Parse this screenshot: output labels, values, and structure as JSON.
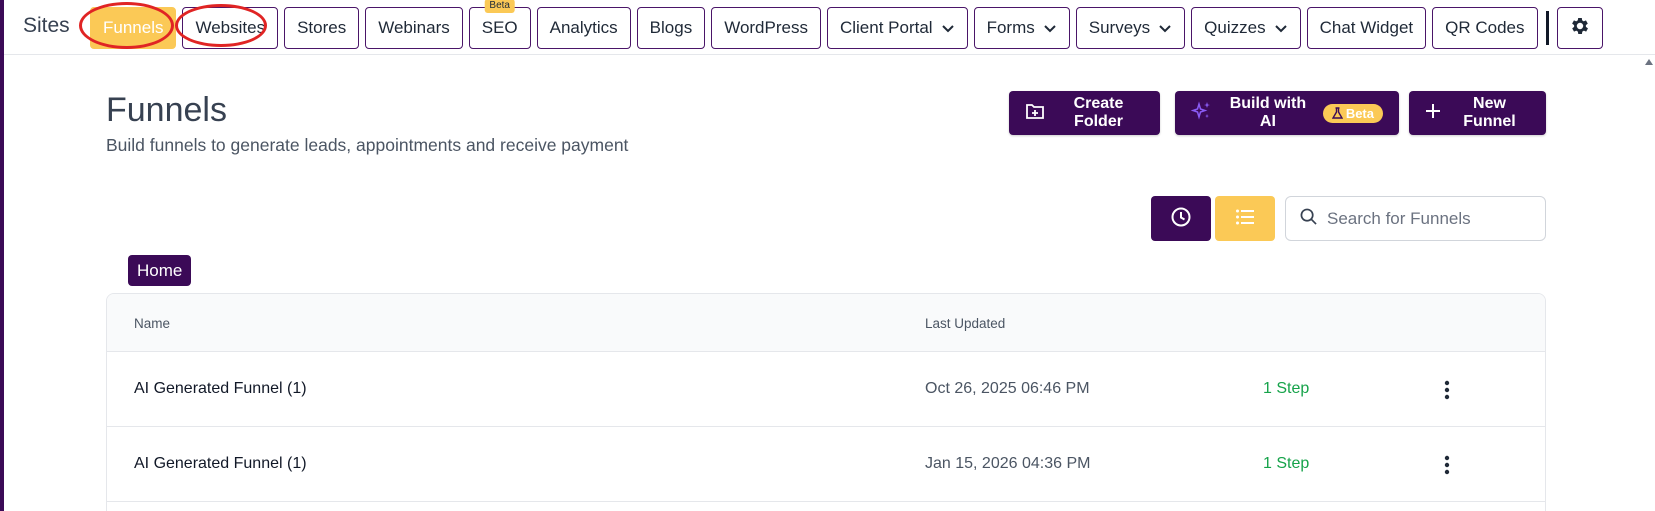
{
  "nav": {
    "brand": "Sites",
    "tabs": [
      {
        "label": "Funnels",
        "active": true
      },
      {
        "label": "Websites"
      },
      {
        "label": "Stores"
      },
      {
        "label": "Webinars"
      },
      {
        "label": "SEO",
        "badge": "Beta"
      },
      {
        "label": "Analytics"
      },
      {
        "label": "Blogs"
      },
      {
        "label": "WordPress"
      },
      {
        "label": "Client Portal",
        "dropdown": true
      },
      {
        "label": "Forms",
        "dropdown": true
      },
      {
        "label": "Surveys",
        "dropdown": true
      },
      {
        "label": "Quizzes",
        "dropdown": true
      },
      {
        "label": "Chat Widget"
      },
      {
        "label": "QR Codes"
      }
    ],
    "settings_icon": "gear-icon"
  },
  "header": {
    "title": "Funnels",
    "subtitle": "Build funnels to generate leads, appointments and receive payment"
  },
  "actions": {
    "create_folder": "Create Folder",
    "build_ai": "Build with AI",
    "build_ai_badge": "Beta",
    "new_funnel": "New Funnel"
  },
  "search": {
    "placeholder": "Search for Funnels",
    "value": ""
  },
  "breadcrumb": {
    "home": "Home"
  },
  "table": {
    "columns": [
      "Name",
      "Last Updated"
    ],
    "rows": [
      {
        "name": "AI Generated Funnel (1)",
        "updated": "Oct 26, 2025 06:46 PM",
        "steps": "1 Step"
      },
      {
        "name": "AI Generated Funnel (1)",
        "updated": "Jan 15, 2026 04:36 PM",
        "steps": "1 Step"
      }
    ]
  },
  "colors": {
    "primary": "#3b0a57",
    "accent": "#fbc956",
    "success": "#16a34a",
    "annotation": "#e02424"
  }
}
